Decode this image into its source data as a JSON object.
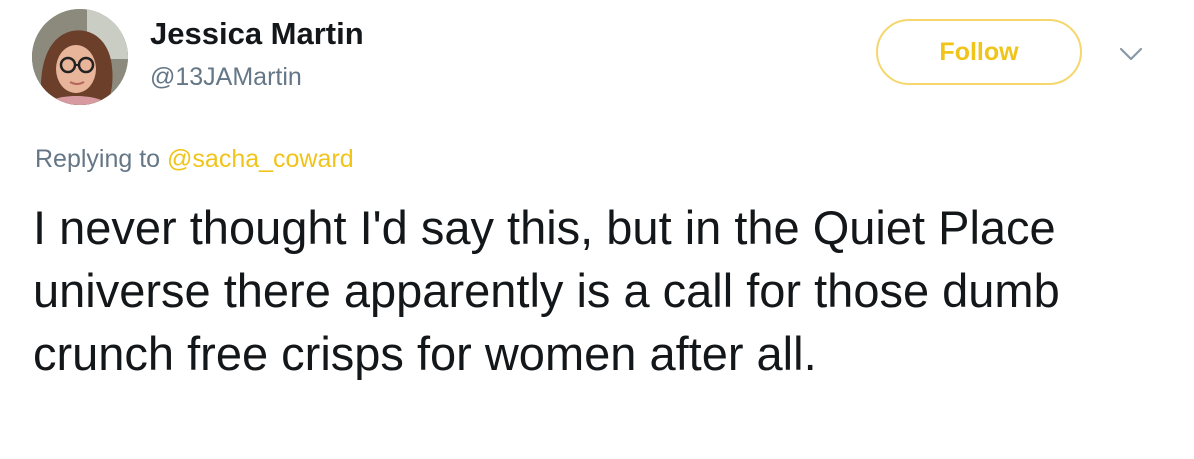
{
  "user": {
    "display_name": "Jessica Martin",
    "handle": "@13JAMartin",
    "avatar_icon": "profile-photo"
  },
  "actions": {
    "follow_label": "Follow",
    "more_icon": "chevron-down-icon"
  },
  "reply": {
    "prefix": "Replying to",
    "target": "@sacha_coward"
  },
  "tweet": {
    "text": "I never thought I'd say this, but in the Quiet Place universe there apparently is a call for those dumb crunch free crisps for women after all."
  },
  "colors": {
    "accent": "#f0c419",
    "accent_border": "#f5d76e",
    "secondary_text": "#657786",
    "primary_text": "#14171a"
  }
}
